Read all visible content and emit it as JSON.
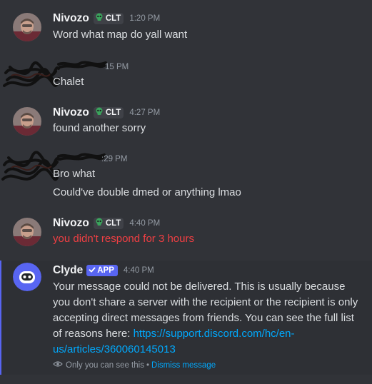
{
  "colors": {
    "background": "#313338",
    "username": "#f2f3f5",
    "text": "#dbdee1",
    "timestamp": "#949ba4",
    "error_text": "#f23f43",
    "link": "#00a8fc",
    "app_badge": "#5865f2",
    "tag_skull": "#3ba55d"
  },
  "messages": [
    {
      "author": "Nivozo",
      "tag": "CLT",
      "tag_icon": "skull-icon",
      "time": "1:20 PM",
      "lines": [
        "Word what map do yall want"
      ]
    },
    {
      "author": "",
      "author_redacted": true,
      "time": "1:15 PM",
      "time_visible_fragment": "15 PM",
      "lines": [
        "Chalet"
      ]
    },
    {
      "author": "Nivozo",
      "tag": "CLT",
      "tag_icon": "skull-icon",
      "time": "4:27 PM",
      "lines": [
        "found another sorry"
      ]
    },
    {
      "author": "",
      "author_redacted": true,
      "time_visible_fragment": ":29 PM",
      "lines": [
        "Bro what",
        "Could've double dmed or anything lmao"
      ]
    },
    {
      "author": "Nivozo",
      "tag": "CLT",
      "tag_icon": "skull-icon",
      "time": "4:40 PM",
      "lines": [
        "you didn't respond for 3 hours"
      ],
      "error": true
    }
  ],
  "clyde": {
    "author": "Clyde",
    "badge": "APP",
    "badge_icon": "checkmark-icon",
    "time": "4:40 PM",
    "message_text": "Your message could not be delivered. This is usually because you don't share a server with the recipient or the recipient is only accepting direct messages from friends. You can see the full list of reasons here: ",
    "link_text": "https://support.discord.com/hc/en-us/articles/360060145013",
    "ephemeral_notice": "Only you can see this",
    "separator": "•",
    "dismiss_label": "Dismiss message"
  }
}
